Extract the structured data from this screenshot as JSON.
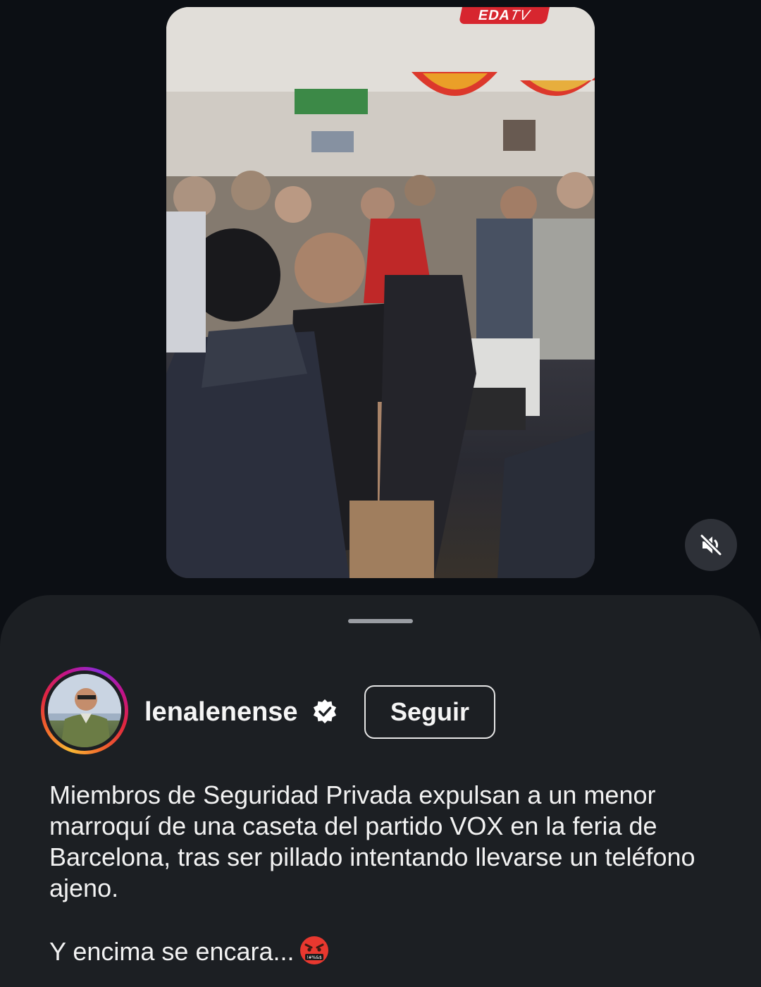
{
  "video": {
    "watermark_brand": "EDA",
    "watermark_suffix": "TV",
    "mute_icon": "speaker-muted-icon"
  },
  "post": {
    "username": "lenalenense",
    "verified_icon": "verified-badge-icon",
    "follow_label": "Seguir",
    "caption_line1": "Miembros de Seguridad Privada expulsan a un menor marroquí de una caseta del partido VOX en la feria de Barcelona, tras ser pillado intentando llevarse un teléfono ajeno.",
    "caption_line2": "Y encima se encara...",
    "caption_emoji": "face-with-symbols-on-mouth-emoji"
  },
  "colors": {
    "background": "#0c0f14",
    "sheet": "#1c1f23",
    "text": "#f5f5f5",
    "watermark": "#d7262f"
  }
}
